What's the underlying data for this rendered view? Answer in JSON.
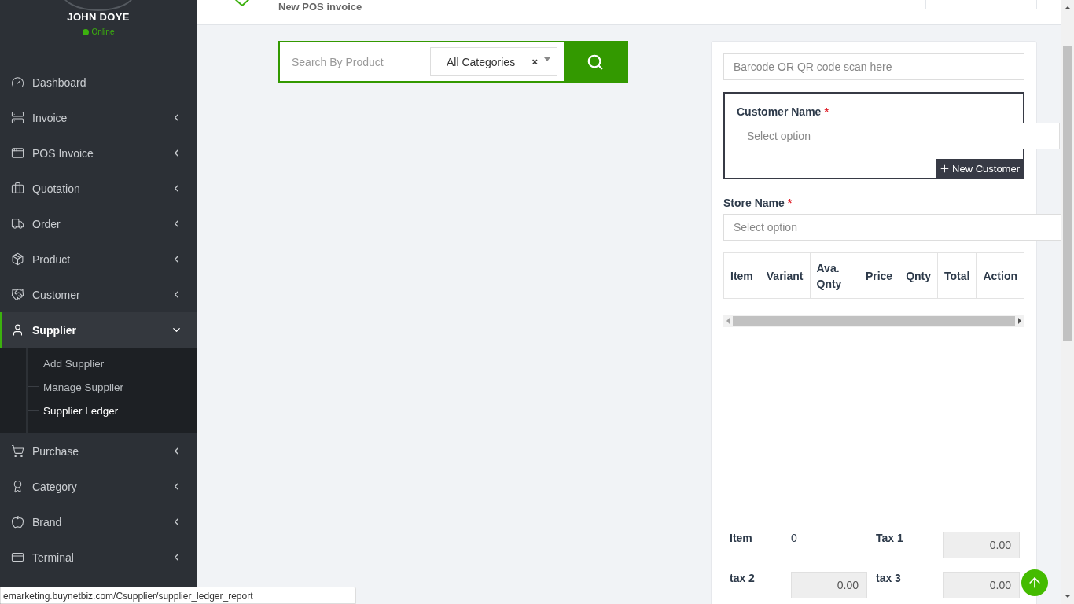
{
  "user": {
    "name": "JOHN DOYE",
    "status": "Online",
    "online": true
  },
  "sidebar": {
    "items": [
      {
        "label": "Dashboard",
        "kind": "link",
        "selected": false
      },
      {
        "label": "Invoice",
        "kind": "menu",
        "selected": false,
        "expanded": false
      },
      {
        "label": "POS Invoice",
        "kind": "menu",
        "selected": false,
        "expanded": false
      },
      {
        "label": "Quotation",
        "kind": "menu",
        "selected": false,
        "expanded": false
      },
      {
        "label": "Order",
        "kind": "menu",
        "selected": false,
        "expanded": false
      },
      {
        "label": "Product",
        "kind": "menu",
        "selected": false,
        "expanded": false
      },
      {
        "label": "Customer",
        "kind": "menu",
        "selected": false,
        "expanded": false
      },
      {
        "label": "Supplier",
        "kind": "menu",
        "selected": true,
        "expanded": true,
        "children": [
          {
            "label": "Add Supplier",
            "selected": false
          },
          {
            "label": "Manage Supplier",
            "selected": false
          },
          {
            "label": "Supplier Ledger",
            "selected": true
          }
        ]
      },
      {
        "label": "Purchase",
        "kind": "menu",
        "selected": false,
        "expanded": false
      },
      {
        "label": "Category",
        "kind": "menu",
        "selected": false,
        "expanded": false
      },
      {
        "label": "Brand",
        "kind": "menu",
        "selected": false,
        "expanded": false
      },
      {
        "label": "Terminal",
        "kind": "menu",
        "selected": false,
        "expanded": false
      }
    ]
  },
  "header": {
    "subtitle": "New POS invoice"
  },
  "search": {
    "placeholder": "Search By Product",
    "category": "All Categories",
    "clear": "×"
  },
  "invoice": {
    "barcode_placeholder": "Barcode OR QR code scan here",
    "customer": {
      "label": "Customer Name",
      "required": "*",
      "placeholder": "Select option",
      "button": "New Customer"
    },
    "store": {
      "label": "Store Name",
      "required": "*",
      "placeholder": "Select option"
    },
    "table": {
      "columns": [
        "Item",
        "Variant",
        "Ava. Qnty",
        "Price",
        "Qnty",
        "Total",
        "Action"
      ]
    },
    "totals": [
      {
        "label": "Item",
        "value": "0",
        "kind": "text"
      },
      {
        "label": "Tax 1",
        "value": "0.00",
        "kind": "field"
      },
      {
        "label": "tax 2",
        "value": "0.00",
        "kind": "field"
      },
      {
        "label": "tax 3",
        "value": "0.00",
        "kind": "field"
      }
    ]
  },
  "status_bar": {
    "url": "emarketing.buynetbiz.com/Csupplier/supplier_ledger_report"
  }
}
